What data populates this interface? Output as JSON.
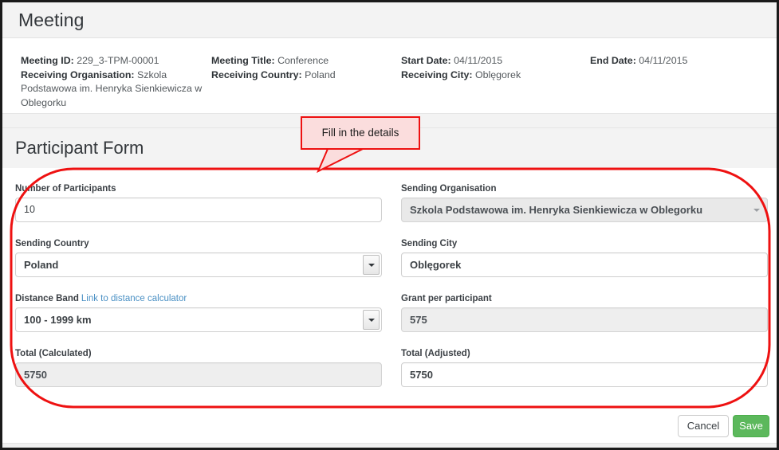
{
  "window": {
    "title": "Meeting"
  },
  "meeting_info": {
    "columns": [
      {
        "lines": [
          {
            "label": "Meeting ID:",
            "value": "229_3-TPM-00001"
          },
          {
            "label": "Receiving Organisation:",
            "value": "Szkola Podstawowa im. Henryka Sienkiewicza w Oblegorku"
          }
        ]
      },
      {
        "lines": [
          {
            "label": "Meeting Title:",
            "value": "Conference"
          },
          {
            "label": "Receiving Country:",
            "value": "Poland"
          }
        ]
      },
      {
        "lines": [
          {
            "label": "Start Date:",
            "value": "04/11/2015"
          },
          {
            "label": "Receiving City:",
            "value": "Oblęgorek"
          }
        ]
      },
      {
        "lines": [
          {
            "label": "End Date:",
            "value": "04/11/2015"
          }
        ]
      }
    ]
  },
  "form": {
    "title": "Participant Form",
    "fields": {
      "number_of_participants": {
        "label": "Number of Participants",
        "value": "10"
      },
      "sending_organisation": {
        "label": "Sending Organisation",
        "value": "Szkola Podstawowa im. Henryka Sienkiewicza w Oblegorku"
      },
      "sending_country": {
        "label": "Sending Country",
        "value": "Poland"
      },
      "sending_city": {
        "label": "Sending City",
        "value": "Oblęgorek"
      },
      "distance_band": {
        "label": "Distance Band",
        "link_label": "Link to distance calculator",
        "value": "100 - 1999 km"
      },
      "grant_per_participant": {
        "label": "Grant per participant",
        "value": "575"
      },
      "total_calculated": {
        "label": "Total (Calculated)",
        "value": "5750"
      },
      "total_adjusted": {
        "label": "Total (Adjusted)",
        "value": "5750"
      }
    }
  },
  "footer": {
    "cancel_label": "Cancel",
    "save_label": "Save"
  },
  "annotation": {
    "callout_text": "Fill in the details",
    "highlight_color": "#ee1111",
    "callout_fill": "#fbdddd"
  },
  "colors": {
    "save_green": "#5cb85c",
    "link_blue": "#4a90c4",
    "band_grey": "#f3f3f3",
    "disabled_grey": "#eeeeee"
  }
}
